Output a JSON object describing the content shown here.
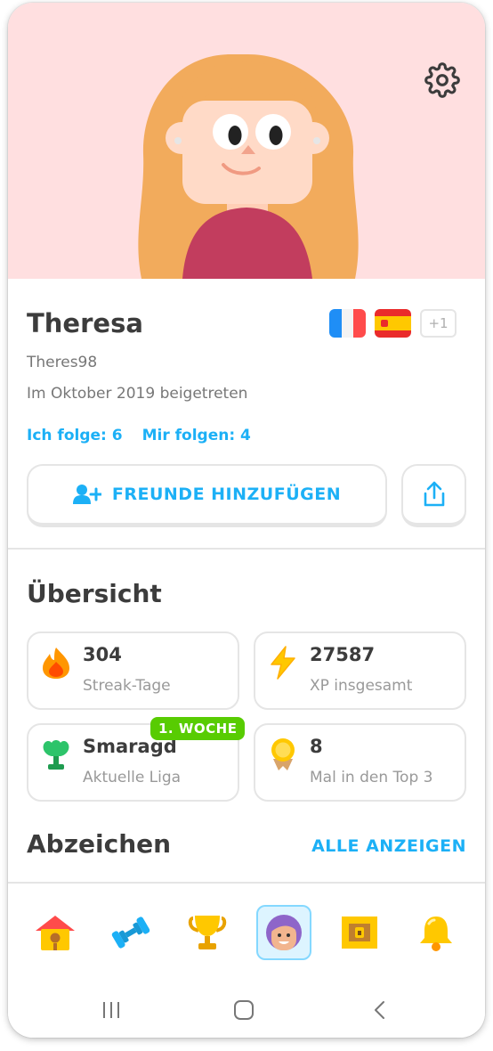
{
  "profile": {
    "name": "Theresa",
    "username": "Theres98",
    "joined": "Im Oktober 2019 beigetreten",
    "following": "Ich folge: 6",
    "followers": "Mir folgen: 4",
    "more_courses": "+1",
    "courses": [
      "french-flag",
      "spanish-flag"
    ]
  },
  "actions": {
    "add_friends": "FREUNDE HINZUFÜGEN"
  },
  "overview": {
    "title": "Übersicht",
    "stats": [
      {
        "value": "304",
        "label": "Streak-Tage",
        "icon": "flame-icon"
      },
      {
        "value": "27587",
        "label": "XP insgesamt",
        "icon": "lightning-icon"
      },
      {
        "value": "Smaragd",
        "label": "Aktuelle Liga",
        "icon": "emerald-trophy-icon"
      },
      {
        "value": "8",
        "label": "Mal in den Top 3",
        "icon": "medal-icon"
      }
    ],
    "league_badge": "1. WOCHE"
  },
  "achievements": {
    "title": "Abzeichen",
    "show_all": "ALLE ANZEIGEN"
  },
  "nav": {
    "tabs": [
      "home",
      "practice",
      "leagues",
      "profile",
      "shop",
      "notifications"
    ],
    "active": "profile"
  },
  "colors": {
    "accent": "#1cb0f6",
    "hero_bg": "#ffdfe0",
    "badge_green": "#58cc02",
    "border": "#e5e5e5"
  }
}
